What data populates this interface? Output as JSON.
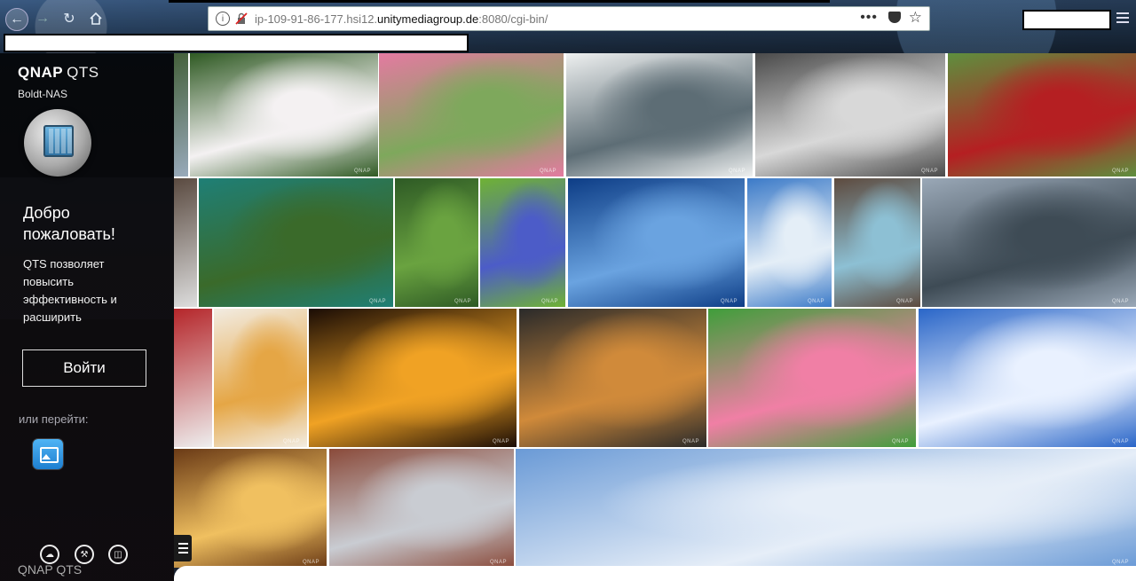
{
  "browser": {
    "url_prefix": "ip-109-91-86-177.hsi12.",
    "url_domain": "unitymediagroup.de",
    "url_suffix": ":8080/cgi-bin/"
  },
  "sidebar": {
    "brand_main": "QNAP",
    "brand_sub": "QTS",
    "nas_name": "Boldt-NAS",
    "welcome": "Добро пожаловать!",
    "description": "QTS позволяет повысить эффективность и расширить мультимедийные",
    "login_label": "Войти",
    "goto_label": "или перейти:",
    "bottom_brand": "QNAP  QTS"
  },
  "gallery": {
    "watermark": "QNAP",
    "photos": [
      {
        "name": "cyclamen",
        "c1": "#2f5a23",
        "c2": "#f4f1f2"
      },
      {
        "name": "pink-blossoms",
        "c1": "#e47aa1",
        "c2": "#7ea85c"
      },
      {
        "name": "misty-pier",
        "c1": "#eef0f0",
        "c2": "#5d6d75"
      },
      {
        "name": "rocky-shore",
        "c1": "#4a4a4a",
        "c2": "#d8d8d8"
      },
      {
        "name": "red-tractor",
        "c1": "#5e8f3e",
        "c2": "#b51f22"
      },
      {
        "name": "heart-stone-weir",
        "c1": "#1f7f76",
        "c2": "#3a6a2a"
      },
      {
        "name": "river-forest",
        "c1": "#2e5a25",
        "c2": "#6aa340"
      },
      {
        "name": "blue-flower",
        "c1": "#6fb234",
        "c2": "#4c5cc8"
      },
      {
        "name": "water-villas",
        "c1": "#0d3d86",
        "c2": "#6aa3e0"
      },
      {
        "name": "yacht-harbor",
        "c1": "#3b7ac8",
        "c2": "#e4eef7"
      },
      {
        "name": "rock-ridges",
        "c1": "#5d4a3e",
        "c2": "#8dc0d4"
      },
      {
        "name": "canal-warehouses",
        "c1": "#9aa8b7",
        "c2": "#3e4b55"
      },
      {
        "name": "ice-cream-cone",
        "c1": "#f2ece2",
        "c2": "#e5a645"
      },
      {
        "name": "carousel-night",
        "c1": "#1a0c05",
        "c2": "#f0a224"
      },
      {
        "name": "rainy-window",
        "c1": "#2a2a2a",
        "c2": "#d08a3a"
      },
      {
        "name": "pink-rose",
        "c1": "#3f9e3a",
        "c2": "#f07fa5"
      },
      {
        "name": "blue-sky-coast",
        "c1": "#2a66c8",
        "c2": "#e9f1ff"
      },
      {
        "name": "gourmet-dish",
        "c1": "#6a3a16",
        "c2": "#f0c060"
      },
      {
        "name": "brick-harbor",
        "c1": "#8a4a3a",
        "c2": "#c9ccd2"
      },
      {
        "name": "panorama-coast",
        "c1": "#6a9ad6",
        "c2": "#e6eef8"
      }
    ]
  }
}
